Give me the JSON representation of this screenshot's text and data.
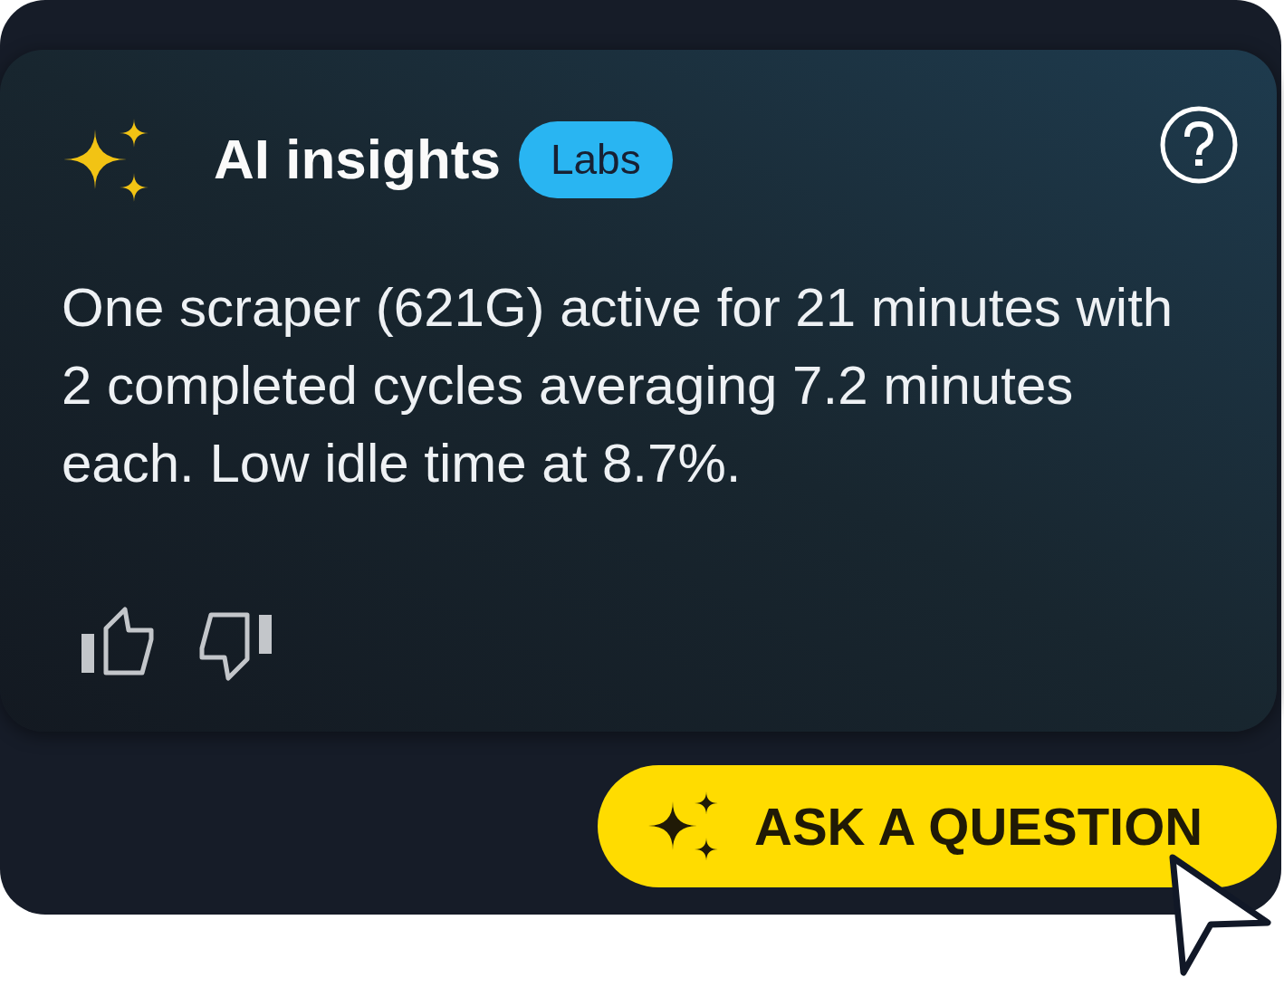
{
  "header": {
    "title": "AI insights",
    "badge": "Labs"
  },
  "insight": {
    "text": "One scraper (621G) active for 21 minutes with 2 completed cycles averaging 7.2 minutes each. Low idle time at 8.7%."
  },
  "feedback": [
    {
      "kind": "thumbs_up"
    },
    {
      "kind": "thumbs_down"
    }
  ],
  "action_button": {
    "label": "ASK A QUESTION"
  }
}
